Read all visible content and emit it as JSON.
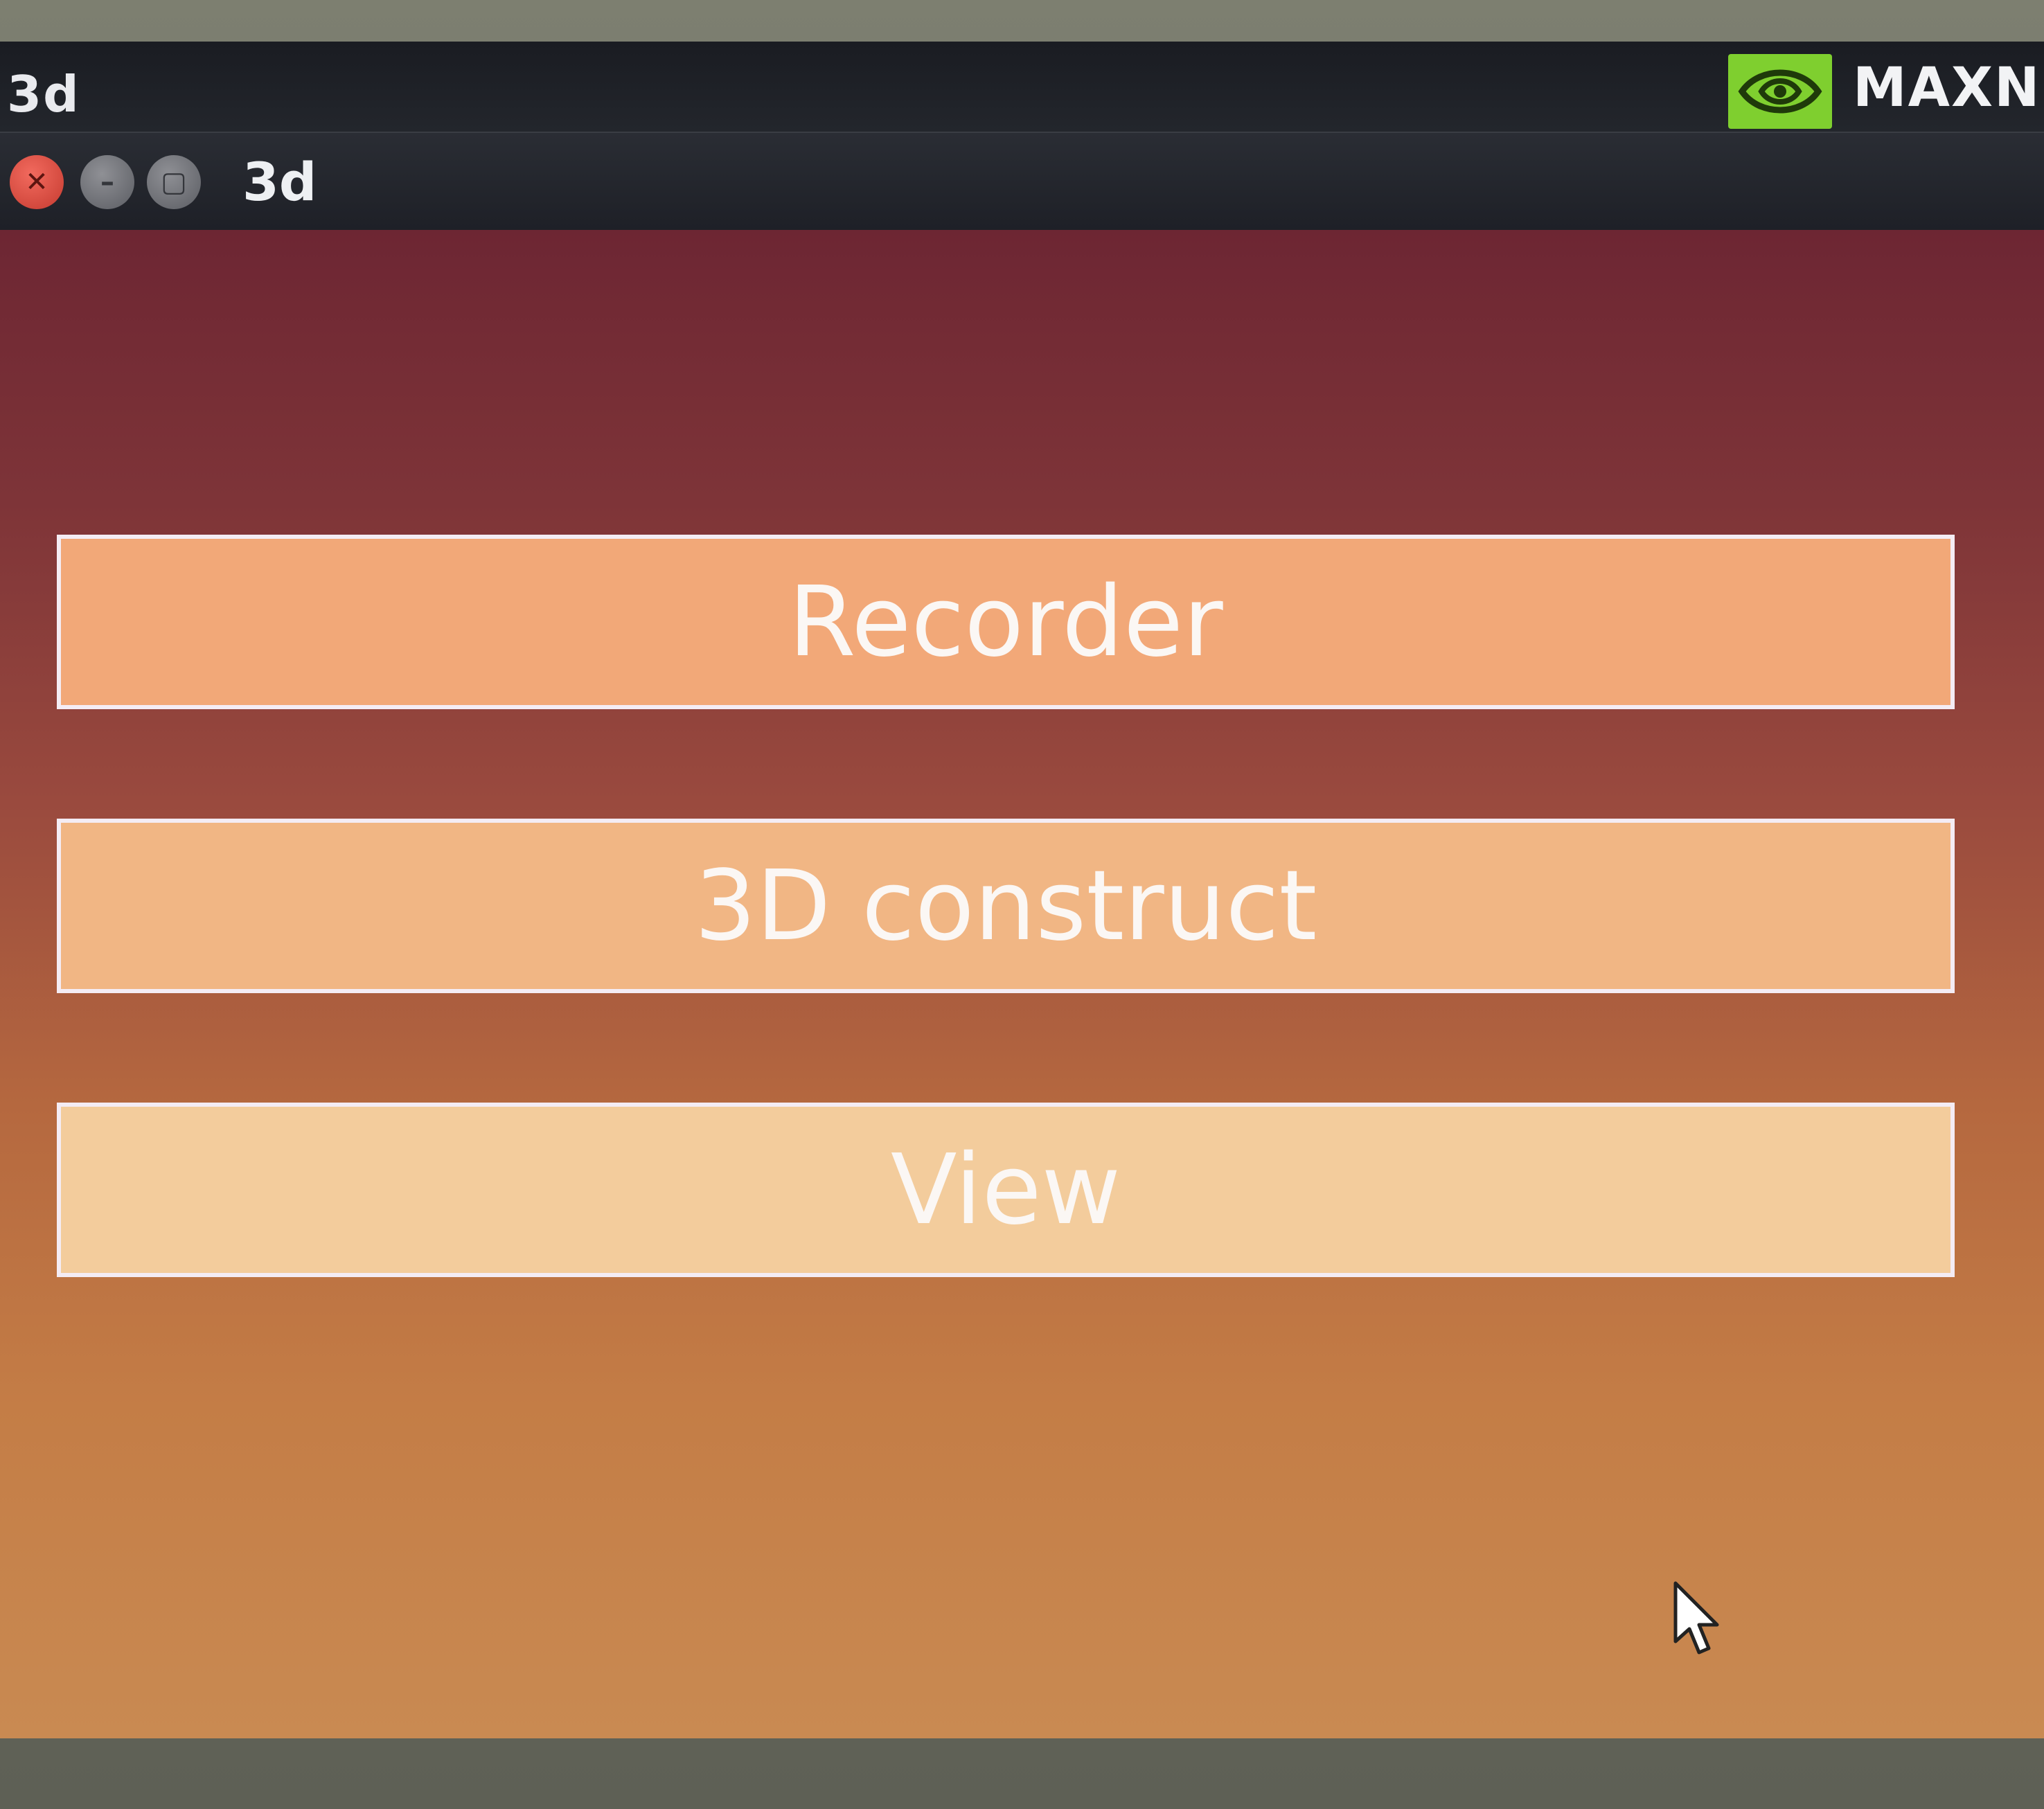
{
  "top_panel": {
    "app_title": "3d",
    "power_mode": "MAXN",
    "tray_icon": "nvidia-logo-icon"
  },
  "window": {
    "title": "3d",
    "controls": {
      "close_icon": "close-icon",
      "minimize_icon": "minimize-icon",
      "maximize_icon": "maximize-icon"
    }
  },
  "menu": {
    "buttons": [
      {
        "label": "Recorder"
      },
      {
        "label": "3D construct"
      },
      {
        "label": "View"
      }
    ]
  },
  "colors": {
    "button_recorder": "#f2a878",
    "button_construct": "#f1b684",
    "button_view": "#f3cc9c",
    "button_border": "#f4ecf4",
    "nvidia_green": "#7fcf2f",
    "close_red": "#e0483c"
  }
}
